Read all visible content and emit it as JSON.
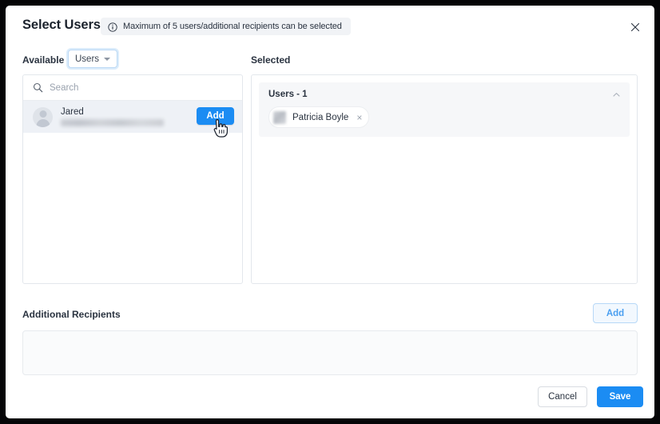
{
  "dialog": {
    "title": "Select Users",
    "info_banner": {
      "icon": "info-circle-icon",
      "text": "Maximum of 5 users/additional recipients can be selected"
    },
    "close_icon": "close-icon"
  },
  "available": {
    "label": "Available",
    "dropdown": {
      "value": "Users",
      "caret_icon": "chevron-down-icon"
    },
    "search": {
      "icon": "search-icon",
      "placeholder": "Search",
      "value": ""
    },
    "rows": [
      {
        "avatar": "avatar-placeholder-icon",
        "name": "Jared",
        "email": "",
        "add_label": "Add"
      }
    ]
  },
  "selected": {
    "label": "Selected",
    "group": {
      "title": "Users - 1",
      "collapse_icon": "chevron-up-icon",
      "chips": [
        {
          "avatar": "avatar-thumbnail",
          "name": "Patricia Boyle",
          "remove_icon": "close-icon",
          "remove_label": "×"
        }
      ]
    }
  },
  "additional_recipients": {
    "label": "Additional Recipients",
    "add_label": "Add",
    "items": []
  },
  "footer": {
    "cancel_label": "Cancel",
    "save_label": "Save"
  },
  "cursor": {
    "type": "pointer-hand-cursor"
  },
  "colors": {
    "accent_blue": "#1b8cf3",
    "outline_blue": "#b7d8f7",
    "panel_border": "#e3e7ec",
    "row_hover": "#eef1f6",
    "group_bg": "#f6f7f9",
    "text_dark": "#2a3340",
    "frame": "#050507"
  }
}
